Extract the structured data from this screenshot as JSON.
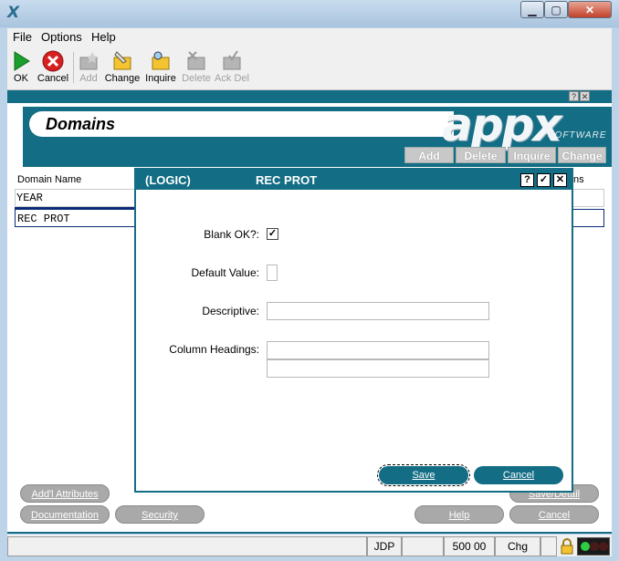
{
  "window": {
    "min": "▁",
    "max": "▢",
    "close": "✕"
  },
  "menu": [
    "File",
    "Options",
    "Help"
  ],
  "toolbar": [
    {
      "label": "OK",
      "icon": "ok-icon"
    },
    {
      "label": "Cancel",
      "icon": "cancel-icon"
    },
    {
      "label": "Add",
      "icon": "add-icon"
    },
    {
      "label": "Change",
      "icon": "change-icon"
    },
    {
      "label": "Inquire",
      "icon": "inquire-icon"
    },
    {
      "label": "Delete",
      "icon": "delete-icon"
    },
    {
      "label": "Ack Del",
      "icon": "ack-del-icon"
    }
  ],
  "header": {
    "title": "Domains",
    "logo": "appx",
    "logo_sub": "SOFTWARE",
    "buttons": [
      "Add",
      "Delete",
      "Inquire",
      "Change"
    ]
  },
  "list": {
    "col_name": "Domain Name",
    "col_right": "ns",
    "rows": [
      "YEAR",
      "REC PROT"
    ]
  },
  "dialog": {
    "title_left": "(LOGIC)",
    "title_right": "REC PROT",
    "help_btn": "?",
    "ok_btn": "✓",
    "close_btn": "✕",
    "blank_ok_label": "Blank OK?:",
    "blank_ok_check": "✓",
    "default_value_label": "Default Value:",
    "descriptive_label": "Descriptive:",
    "column_headings_label": "Column Headings:",
    "save": "Save",
    "cancel": "Cancel"
  },
  "bottom_buttons": {
    "addl": "Add'l Attributes",
    "documentation": "Documentation",
    "security": "Security",
    "save_detail": "Save/Detail",
    "help": "Help",
    "cancel": "Cancel"
  },
  "status": {
    "user": "JDP",
    "code": "500 00",
    "mode": "Chg"
  },
  "colors": {
    "accent": "#136d84",
    "status_green": "#2ecc40",
    "status_red": "#c0392b"
  }
}
